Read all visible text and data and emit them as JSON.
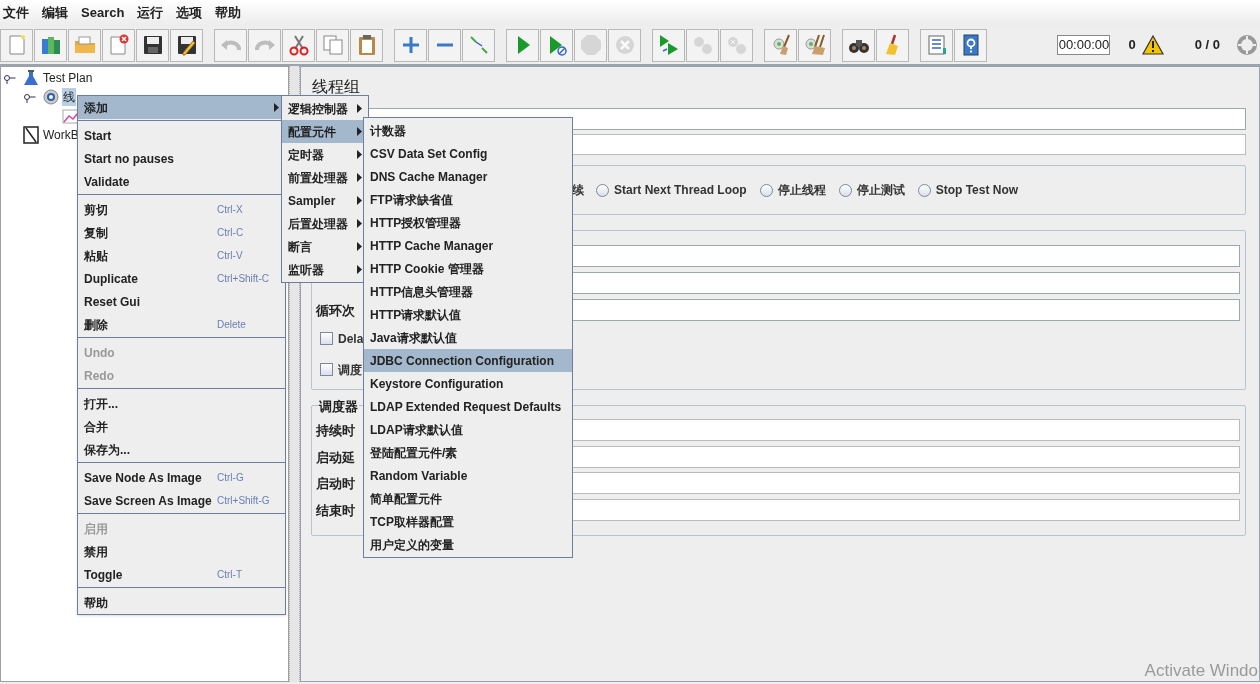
{
  "menu_bar": [
    "文件",
    "编辑",
    "Search",
    "运行",
    "选项",
    "帮助"
  ],
  "toolbar": {
    "groups": [
      [
        {
          "kind": "new",
          "disabled": false
        },
        {
          "kind": "templates",
          "disabled": false
        },
        {
          "kind": "open",
          "disabled": false
        },
        {
          "kind": "close",
          "disabled": false
        },
        {
          "kind": "save",
          "disabled": false
        },
        {
          "kind": "save_as",
          "disabled": false
        }
      ],
      [
        {
          "kind": "undo",
          "disabled": true
        },
        {
          "kind": "redo",
          "disabled": true
        },
        {
          "kind": "cut",
          "disabled": false
        },
        {
          "kind": "copy",
          "disabled": false
        },
        {
          "kind": "paste",
          "disabled": false
        }
      ],
      [
        {
          "kind": "expand",
          "disabled": false
        },
        {
          "kind": "collapse",
          "disabled": false
        },
        {
          "kind": "toggle",
          "disabled": false
        }
      ],
      [
        {
          "kind": "start",
          "disabled": false
        },
        {
          "kind": "start_no_pause",
          "disabled": false
        },
        {
          "kind": "stop",
          "disabled": true
        },
        {
          "kind": "shutdown",
          "disabled": true
        }
      ],
      [
        {
          "kind": "remote_start",
          "disabled": false
        },
        {
          "kind": "remote_stop",
          "disabled": true
        },
        {
          "kind": "remote_shutdown",
          "disabled": true
        }
      ],
      [
        {
          "kind": "clear",
          "disabled": false
        },
        {
          "kind": "clear_all",
          "disabled": false
        }
      ],
      [
        {
          "kind": "search",
          "disabled": false
        },
        {
          "kind": "reset_search",
          "disabled": false
        }
      ],
      [
        {
          "kind": "function_helper",
          "disabled": false
        },
        {
          "kind": "help",
          "disabled": false
        }
      ]
    ],
    "timer": "00:00:00",
    "warning_count": "0",
    "threads": "0 / 0"
  },
  "tree": [
    {
      "label": "Test Plan",
      "kind": "plan",
      "expanded": true,
      "selected": false,
      "children": [
        {
          "label": "线",
          "kind": "thread_group",
          "expanded": true,
          "selected": true,
          "children": [
            {
              "kind": "listener"
            }
          ]
        }
      ]
    },
    {
      "label": "WorkB",
      "kind": "workbench",
      "selected": false
    }
  ],
  "editor": {
    "title": "线程组",
    "sampler_error_options": [
      {
        "label": "续",
        "kind": "fragment"
      },
      {
        "label": "Start Next Thread Loop",
        "kind": "radio",
        "selected": false
      },
      {
        "label": "停止线程",
        "kind": "radio",
        "selected": false
      },
      {
        "label": "停止测试",
        "kind": "radio",
        "selected": false
      },
      {
        "label": "Stop Test Now",
        "kind": "radio",
        "selected": false
      }
    ],
    "thread_fields": [
      {
        "kind": "text"
      },
      {
        "kind": "text"
      },
      {
        "kind": "text",
        "label": "循环次"
      }
    ],
    "thread_checks": [
      {
        "label": "Dela",
        "checked": false
      },
      {
        "label": "调度",
        "checked": false
      }
    ],
    "scheduler": {
      "legend": "调度器",
      "fields": [
        {
          "label": "持续时"
        },
        {
          "label": "启动延"
        },
        {
          "label": "启动时"
        },
        {
          "label": "结束时"
        }
      ]
    }
  },
  "context_menu": {
    "groups": [
      [
        {
          "label": "添加",
          "submenu": true,
          "selected": true,
          "disabled": false
        }
      ],
      [
        {
          "label": "Start",
          "selected": false,
          "disabled": false
        },
        {
          "label": "Start no pauses",
          "selected": false,
          "disabled": false
        },
        {
          "label": "Validate",
          "selected": false,
          "disabled": false
        }
      ],
      [
        {
          "label": "剪切",
          "shortcut": "Ctrl-X",
          "selected": false,
          "disabled": false
        },
        {
          "label": "复制",
          "shortcut": "Ctrl-C",
          "selected": false,
          "disabled": false
        },
        {
          "label": "粘贴",
          "shortcut": "Ctrl-V",
          "selected": false,
          "disabled": false
        },
        {
          "label": "Duplicate",
          "shortcut": "Ctrl+Shift-C",
          "selected": false,
          "disabled": false
        },
        {
          "label": "Reset Gui",
          "selected": false,
          "disabled": false
        },
        {
          "label": "删除",
          "shortcut": "Delete",
          "selected": false,
          "disabled": false
        }
      ],
      [
        {
          "label": "Undo",
          "selected": false,
          "disabled": true
        },
        {
          "label": "Redo",
          "selected": false,
          "disabled": true
        }
      ],
      [
        {
          "label": "打开...",
          "selected": false,
          "disabled": false
        },
        {
          "label": "合并",
          "selected": false,
          "disabled": false
        },
        {
          "label": "保存为...",
          "selected": false,
          "disabled": false
        }
      ],
      [
        {
          "label": "Save Node As Image",
          "shortcut": "Ctrl-G",
          "selected": false,
          "disabled": false
        },
        {
          "label": "Save Screen As Image",
          "shortcut": "Ctrl+Shift-G",
          "selected": false,
          "disabled": false
        }
      ],
      [
        {
          "label": "启用",
          "selected": false,
          "disabled": true
        },
        {
          "label": "禁用",
          "selected": false,
          "disabled": false
        },
        {
          "label": "Toggle",
          "shortcut": "Ctrl-T",
          "selected": false,
          "disabled": false
        }
      ],
      [
        {
          "label": "帮助",
          "selected": false,
          "disabled": false
        }
      ]
    ]
  },
  "add_submenu": [
    {
      "label": "逻辑控制器",
      "selected": false
    },
    {
      "label": "配置元件",
      "selected": true
    },
    {
      "label": "定时器",
      "selected": false
    },
    {
      "label": "前置处理器",
      "selected": false
    },
    {
      "label": "Sampler",
      "selected": false
    },
    {
      "label": "后置处理器",
      "selected": false
    },
    {
      "label": "断言",
      "selected": false
    },
    {
      "label": "监听器",
      "selected": false
    }
  ],
  "config_submenu": [
    {
      "label": "计数器",
      "selected": false
    },
    {
      "label": "CSV Data Set Config",
      "selected": false
    },
    {
      "label": "DNS Cache Manager",
      "selected": false
    },
    {
      "label": "FTP请求缺省值",
      "selected": false
    },
    {
      "label": "HTTP授权管理器",
      "selected": false
    },
    {
      "label": "HTTP Cache Manager",
      "selected": false
    },
    {
      "label": "HTTP Cookie 管理器",
      "selected": false
    },
    {
      "label": "HTTP信息头管理器",
      "selected": false
    },
    {
      "label": "HTTP请求默认值",
      "selected": false
    },
    {
      "label": "Java请求默认值",
      "selected": false
    },
    {
      "label": "JDBC Connection Configuration",
      "selected": true
    },
    {
      "label": "Keystore Configuration",
      "selected": false
    },
    {
      "label": "LDAP Extended Request Defaults",
      "selected": false
    },
    {
      "label": "LDAP请求默认值",
      "selected": false
    },
    {
      "label": "登陆配置元件/素",
      "selected": false
    },
    {
      "label": "Random Variable",
      "selected": false
    },
    {
      "label": "简单配置元件",
      "selected": false
    },
    {
      "label": "TCP取样器配置",
      "selected": false
    },
    {
      "label": "用户定义的变量",
      "selected": false
    }
  ],
  "os_notice": "Activate Windo"
}
